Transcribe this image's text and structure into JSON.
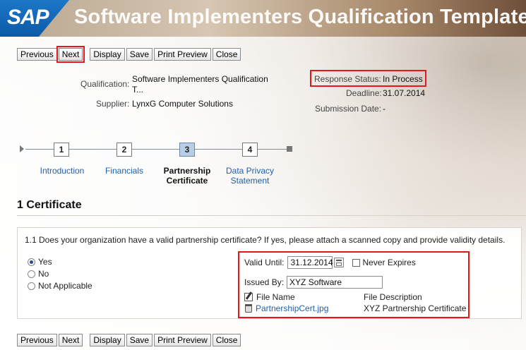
{
  "header": {
    "logo": "SAP",
    "title": "Software Implementers Qualification Template"
  },
  "toolbar": {
    "previous": "Previous",
    "next": "Next",
    "display": "Display",
    "save": "Save",
    "print_preview": "Print Preview",
    "close": "Close"
  },
  "info": {
    "qualification_label": "Qualification:",
    "qualification_value_line1": "Software Implementers Qualification",
    "qualification_value_line2": "T...",
    "supplier_label": "Supplier:",
    "supplier_value": "LynxG Computer Solutions",
    "response_status_label": "Response Status:",
    "response_status_value": "In Process",
    "deadline_label": "Deadline:",
    "deadline_value": "31.07.2014",
    "submission_label": "Submission Date:",
    "submission_value": "-"
  },
  "wizard": {
    "steps": [
      {
        "number": "1",
        "label_line1": "Introduction",
        "label_line2": ""
      },
      {
        "number": "2",
        "label_line1": "Financials",
        "label_line2": ""
      },
      {
        "number": "3",
        "label_line1": "Partnership",
        "label_line2": "Certificate"
      },
      {
        "number": "4",
        "label_line1": "Data Privacy",
        "label_line2": "Statement"
      }
    ],
    "active_step": "3"
  },
  "section": {
    "title": "1 Certificate"
  },
  "question": {
    "text": "1.1 Does your organization have a valid partnership certificate? If yes, please attach a scanned copy and provide validity details.",
    "options": [
      "Yes",
      "No",
      "Not Applicable"
    ],
    "selected": "Yes"
  },
  "details": {
    "valid_until_label": "Valid Until:",
    "valid_until_value": "31.12.2014",
    "never_expires_label": "Never Expires",
    "issued_by_label": "Issued By:",
    "issued_by_value": "XYZ Software",
    "col_file_name": "File Name",
    "col_file_description": "File Description",
    "file_name": "PartnershipCert.jpg",
    "file_description": "XYZ Partnership Certificate"
  },
  "colors": {
    "highlight": "#e8151b",
    "link": "#1f5fa8",
    "sap_blue": "#0b5aa8"
  }
}
